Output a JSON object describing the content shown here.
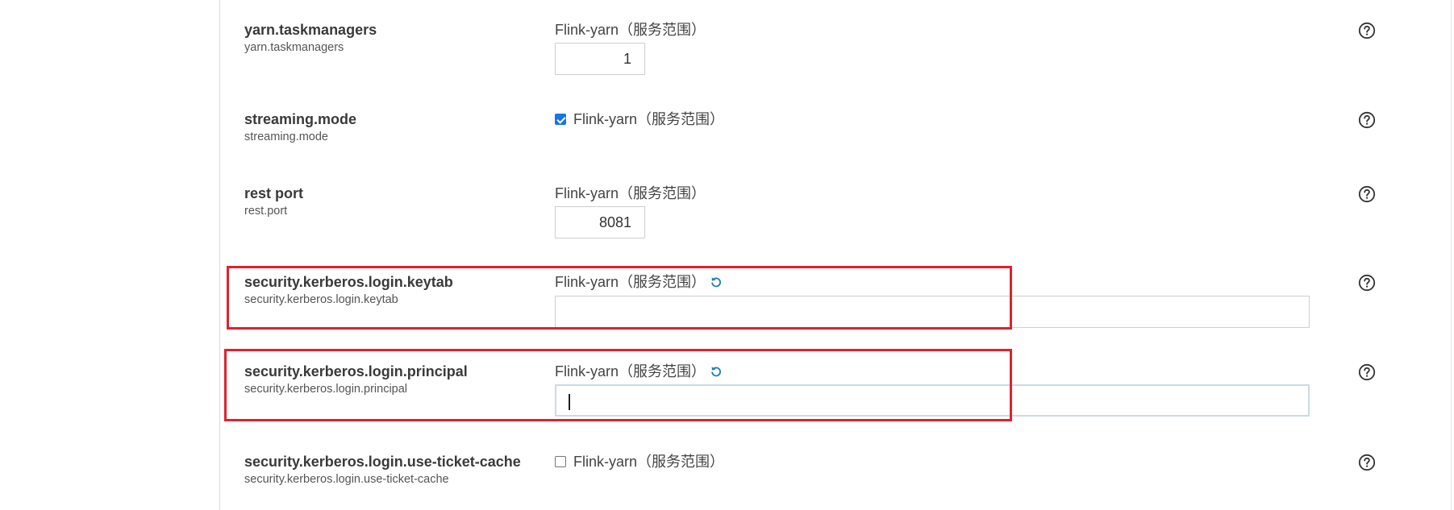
{
  "rows": [
    {
      "title": "yarn.taskmanagers",
      "sub": "yarn.taskmanagers",
      "scope": "Flink-yarn（服务范围）",
      "value": "1"
    },
    {
      "title": "streaming.mode",
      "sub": "streaming.mode",
      "scope": "Flink-yarn（服务范围）",
      "checked": true
    },
    {
      "title": "rest port",
      "sub": "rest.port",
      "scope": "Flink-yarn（服务范围）",
      "value": "8081"
    },
    {
      "title": "security.kerberos.login.keytab",
      "sub": "security.kerberos.login.keytab",
      "scope": "Flink-yarn（服务范围）",
      "value": ""
    },
    {
      "title": "security.kerberos.login.principal",
      "sub": "security.kerberos.login.principal",
      "scope": "Flink-yarn（服务范围）",
      "value": ""
    },
    {
      "title": "security.kerberos.login.use-ticket-cache",
      "sub": "security.kerberos.login.use-ticket-cache",
      "scope": "Flink-yarn（服务范围）",
      "checked": false
    }
  ],
  "icons": {
    "help": "help-circle-icon",
    "undo": "undo-icon"
  },
  "colors": {
    "highlight": "#e3202b",
    "accent": "#1a73e8",
    "undo": "#1a7bb8"
  }
}
